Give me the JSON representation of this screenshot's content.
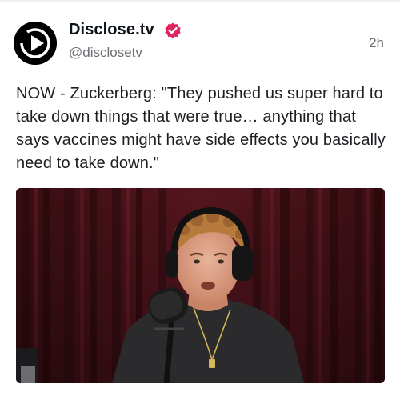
{
  "post": {
    "display_name": "Disclose.tv",
    "handle": "@disclosetv",
    "timestamp": "2h",
    "text": "NOW - Zuckerberg: \"They pushed us super hard to take down things that were true… anything that says vaccines might have side effects you basically need to take down.\"",
    "verified": true,
    "avatar_icon": "play-icon",
    "verified_icon": "verified-badge-icon",
    "media_description_icon": "video-thumbnail"
  },
  "colors": {
    "verified_badge": "#e0245e",
    "handle_gray": "#6b6f73",
    "curtain_red": "#5a1620"
  }
}
